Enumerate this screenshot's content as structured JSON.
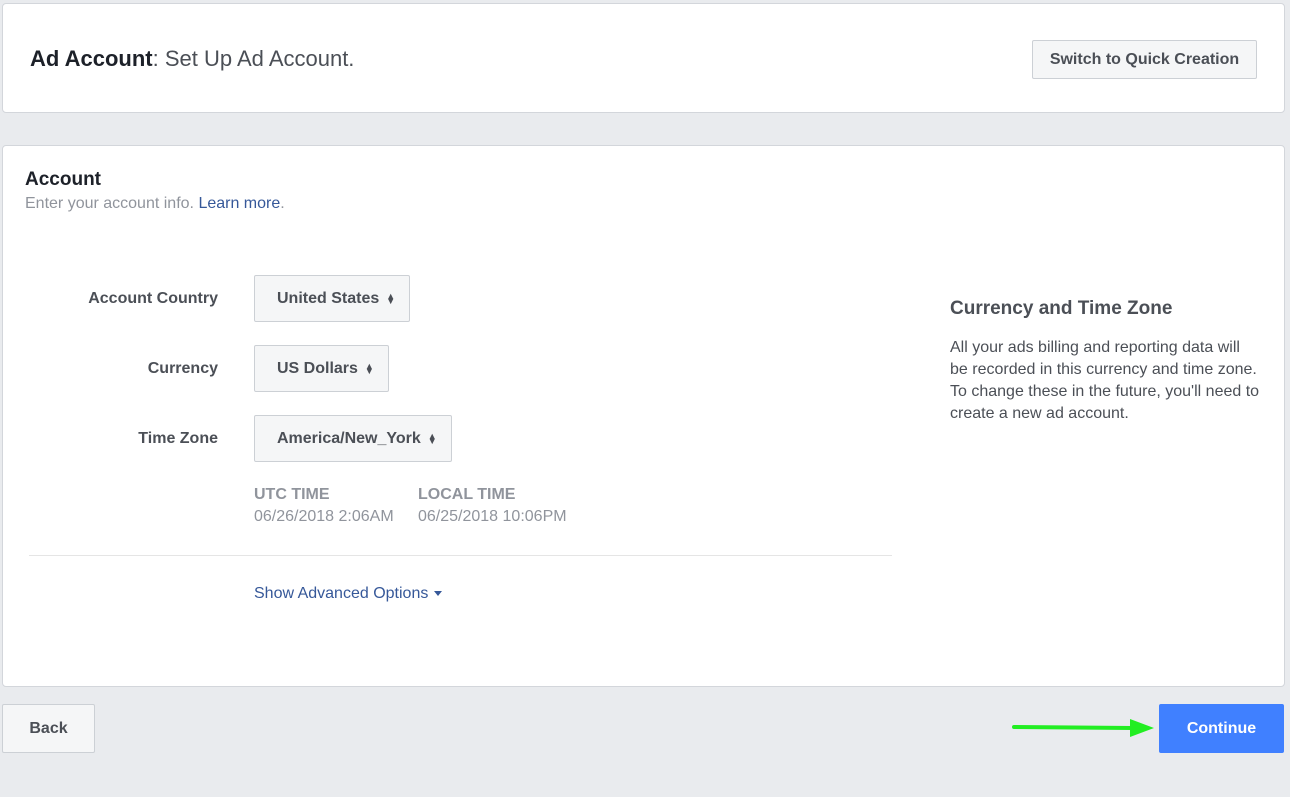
{
  "header": {
    "title_bold": "Ad Account",
    "title_rest": ": Set Up Ad Account.",
    "quick_creation_label": "Switch to Quick Creation"
  },
  "account": {
    "title": "Account",
    "subtitle": "Enter your account info.",
    "learn_more": "Learn more",
    "subtitle_end": "."
  },
  "fields": {
    "country_label": "Account Country",
    "country_value": "United States",
    "currency_label": "Currency",
    "currency_value": "US Dollars",
    "timezone_label": "Time Zone",
    "timezone_value": "America/New_York"
  },
  "times": {
    "utc_label": "UTC TIME",
    "utc_value": "06/26/2018 2:06AM",
    "local_label": "LOCAL TIME",
    "local_value": "06/25/2018 10:06PM"
  },
  "advanced": {
    "label": "Show Advanced Options"
  },
  "side": {
    "title": "Currency and Time Zone",
    "text": "All your ads billing and reporting data will be recorded in this currency and time zone. To change these in the future, you'll need to create a new ad account."
  },
  "footer": {
    "back_label": "Back",
    "continue_label": "Continue"
  },
  "colors": {
    "accent": "#4080ff",
    "link": "#365899",
    "arrow": "#22ee22"
  },
  "icons": {
    "select_arrows": "up-down-arrows-icon",
    "caret": "caret-down-icon",
    "annotation": "green-arrow-icon"
  }
}
